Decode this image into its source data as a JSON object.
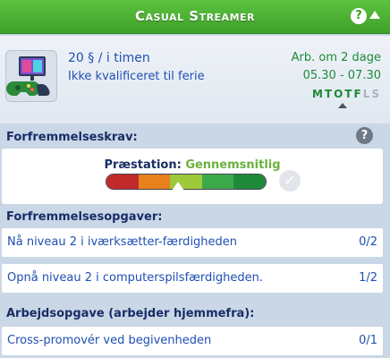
{
  "header": {
    "title": "Casual Streamer",
    "help_glyph": "?"
  },
  "job": {
    "icon": "gaming-controller-monitor-icon",
    "pay": "20 § / i timen",
    "vacation": "Ikke kvalificeret til ferie",
    "work_in": "Arb. om 2 dage",
    "hours": "05.30 - 07.30",
    "days": [
      {
        "label": "M",
        "active": true
      },
      {
        "label": "T",
        "active": true
      },
      {
        "label": "O",
        "active": true
      },
      {
        "label": "T",
        "active": true
      },
      {
        "label": "F",
        "active": true
      },
      {
        "label": "L",
        "active": false
      },
      {
        "label": "S",
        "active": false
      }
    ]
  },
  "promotion": {
    "section_label": "Forfremmelseskrav:",
    "help_glyph": "?",
    "performance_label": "Præstation:",
    "performance_value": "Gennemsnitlig",
    "meter_colors": [
      "#c02a2a",
      "#e8801e",
      "#9ec93a",
      "#3caa4a",
      "#1e8a3a"
    ],
    "meter_level": 0.45,
    "check_glyph": "✓"
  },
  "promotion_tasks": {
    "section_label": "Forfremmelsesopgaver:",
    "items": [
      {
        "label": "Nå niveau 2 i iværksætter-færdigheden",
        "progress": "0/2"
      },
      {
        "label": "Opnå niveau 2 i computerspilsfærdigheden.",
        "progress": "1/2"
      }
    ]
  },
  "work_tasks": {
    "section_label": "Arbejdsopgave (arbejder hjemmefra):",
    "items": [
      {
        "label": "Cross-promovér ved begivenheden",
        "progress": "0/1"
      }
    ]
  },
  "colors": {
    "header_green": "#4cb236",
    "text_blue": "#1f4fb4",
    "text_green": "#1d8a38",
    "section_navy": "#1a2c66",
    "panel_bg": "#c9d7e6"
  }
}
